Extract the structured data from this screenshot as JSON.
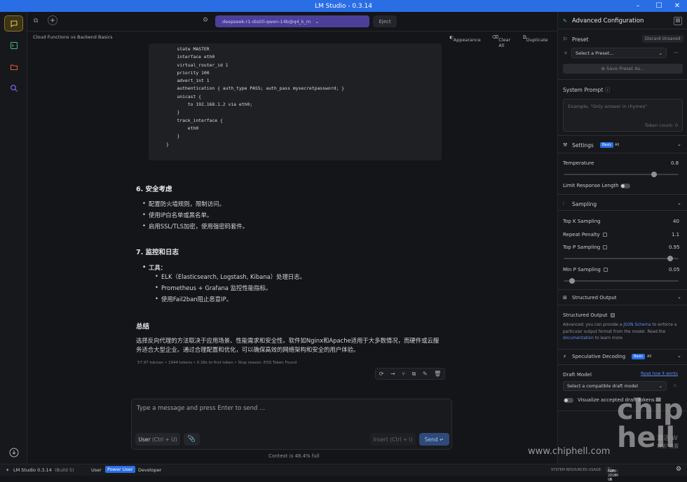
{
  "window": {
    "title": "LM Studio - 0.3.14"
  },
  "topbar": {
    "model": "deepseek-r1-distill-qwen-14b@q4_k_m",
    "eject": "Eject"
  },
  "subbar": {
    "chat_title": "Cloud Functions vs Backend Basics",
    "appearance": "Appearance",
    "clear_all": "Clear All",
    "duplicate": "Duplicate"
  },
  "code": [
    "    state MASTER",
    "    interface eth0",
    "    virtual_router_id 1",
    "    priority 100",
    "    advert_int 1",
    "    authentication { auth_type PASS; auth_pass mysecretpassword; }",
    "    unicast {",
    "        to 192.168.1.2 via eth0;",
    "    }",
    "    track_interface {",
    "        eth0",
    "    }",
    "}"
  ],
  "sections": {
    "s6_title": "6. 安全考虑",
    "s6_items": [
      "配置防火墙规则，限制访问。",
      "使用IP白名单或黑名单。",
      "启用SSL/TLS加密，使用强密码套件。"
    ],
    "s7_title": "7. 监控和日志",
    "s7_tool_label": "工具",
    "s7_items": [
      "ELK（Elasticsearch, Logstash, Kibana）处理日志。",
      "Prometheus + Grafana 监控性能指标。",
      "使用Fail2ban阻止恶意IP。"
    ],
    "summary_title": "总结",
    "summary_text": "选择反向代理的方法取决于应用场景、性能需求和安全性。软件如Nginx和Apache适用于大多数情况，而硬件或云服务适合大型企业。通过合理配置和优化，可以确保高效的网络架构和安全的用户体验。"
  },
  "stats": "57.97 tok/sec  •  1944 tokens  •  0.38s to first token  •  Stop reason: EOS Token Found",
  "input": {
    "placeholder": "Type a message and press Enter to send ...",
    "role": "User",
    "role_shortcut": "(Ctrl + U)",
    "insert": "Insert",
    "insert_shortcut": "(Ctrl + I)",
    "send": "Send"
  },
  "context": "Context is 48.4% full",
  "status": {
    "app": "LM Studio 0.3.14",
    "build": "(Build 5)",
    "user": "User",
    "power_user": "Power User",
    "developer": "Developer",
    "resources_label": "SYSTEM RESOURCES USAGE:",
    "ram": "RAM: 2.19 GB",
    "cpu": "CPU: 0.00 %"
  },
  "panel": {
    "title": "Advanced Configuration",
    "preset_label": "Preset",
    "discard": "Discard Unsaved",
    "select_preset": "Select a Preset...",
    "save_preset": "Save Preset As...",
    "system_prompt": "System Prompt",
    "system_placeholder": "Example, \"Only answer in rhymes\"",
    "token_count": "Token count: 0",
    "settings": "Settings",
    "basic": "Basic",
    "all": "All",
    "temperature": "Temperature",
    "temperature_value": "0.8",
    "temperature_level": 0.8,
    "limit_length": "Limit Response Length",
    "sampling": "Sampling",
    "top_k": "Top K Sampling",
    "top_k_value": "40",
    "repeat_penalty": "Repeat Penalty",
    "repeat_penalty_value": "1.1",
    "top_p": "Top P Sampling",
    "top_p_value": "0.95",
    "top_p_level": 0.95,
    "min_p": "Min P Sampling",
    "min_p_value": "0.05",
    "min_p_level": 0.05,
    "structured_output": "Structured Output",
    "structured_output_label": "Structured Output",
    "structured_desc_1": "Advanced: you can provide a ",
    "json_schema": "JSON Schema",
    "structured_desc_2": " to enforce a particular output format from the model. Read the ",
    "documentation": "documentation",
    "structured_desc_3": " to learn more",
    "spec_decoding": "Speculative Decoding",
    "draft_model": "Draft Model",
    "read_how": "Read how it works",
    "select_draft": "Select a compatible draft model",
    "visualize": "Visualize accepted draft tokens"
  },
  "watermark": {
    "brand": "chip hell",
    "url": "www.chiphell.com",
    "win1": "激活 W",
    "win2": "转到\"设置"
  }
}
